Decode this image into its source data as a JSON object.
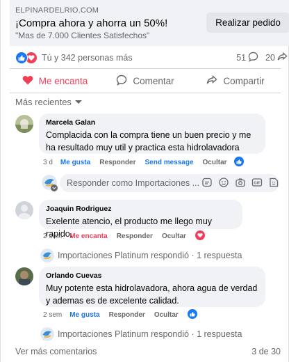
{
  "ad": {
    "domain": "ELPINARDELRIO.COM",
    "title": "¡Compra ahora y ahorra un 50%!",
    "subtitle": "\"Mas de 7.000 Clientes Satisfechos\"",
    "cta_label": "Realizar pedido"
  },
  "reactions": {
    "summary": "Tú y 342 personas más",
    "comments_count": "51",
    "shares_count": "20"
  },
  "actions": {
    "love_label": "Me encanta",
    "comment_label": "Comentar",
    "share_label": "Compartir"
  },
  "sort_label": "Más recientes",
  "comments": [
    {
      "name": "Marcela Galan",
      "text": "Complacida con la compra tiene un buen precio y me ha resultado muy util y practica esta hidrolavadora",
      "time": "3 d",
      "like_label": "Me gusta",
      "reply_label": "Responder",
      "send_message_label": "Send message",
      "hide_label": "Ocultar"
    },
    {
      "name": "Joaquin Rodriguez",
      "text": "Exelente atencio, el producto me llego muy rapido,",
      "time": "2 sem",
      "love_label": "Me encanta",
      "reply_label": "Responder",
      "hide_label": "Ocultar",
      "reply_summary": "Importaciones Platinum respondió · 1 respuesta"
    },
    {
      "name": "Orlando Cuevas",
      "text": "Muy potente esta hidrolavadora, ahora agua de verdad y ademas es de excelente calidad.",
      "time": "2 sem",
      "like_label": "Me gusta",
      "reply_label": "Responder",
      "hide_label": "Ocultar",
      "reply_summary": "Importaciones Platinum respondió · 1 respuesta"
    }
  ],
  "reply_placeholder": "Responder como Importaciones ...",
  "footer": {
    "more_label": "Ver más comentarios",
    "page_count": "3 de 30"
  },
  "colors": {
    "brand_blue": "#1877f2",
    "love_red": "#f33e58",
    "muted_text": "#65676b",
    "bubble_bg": "#f0f2f5"
  }
}
